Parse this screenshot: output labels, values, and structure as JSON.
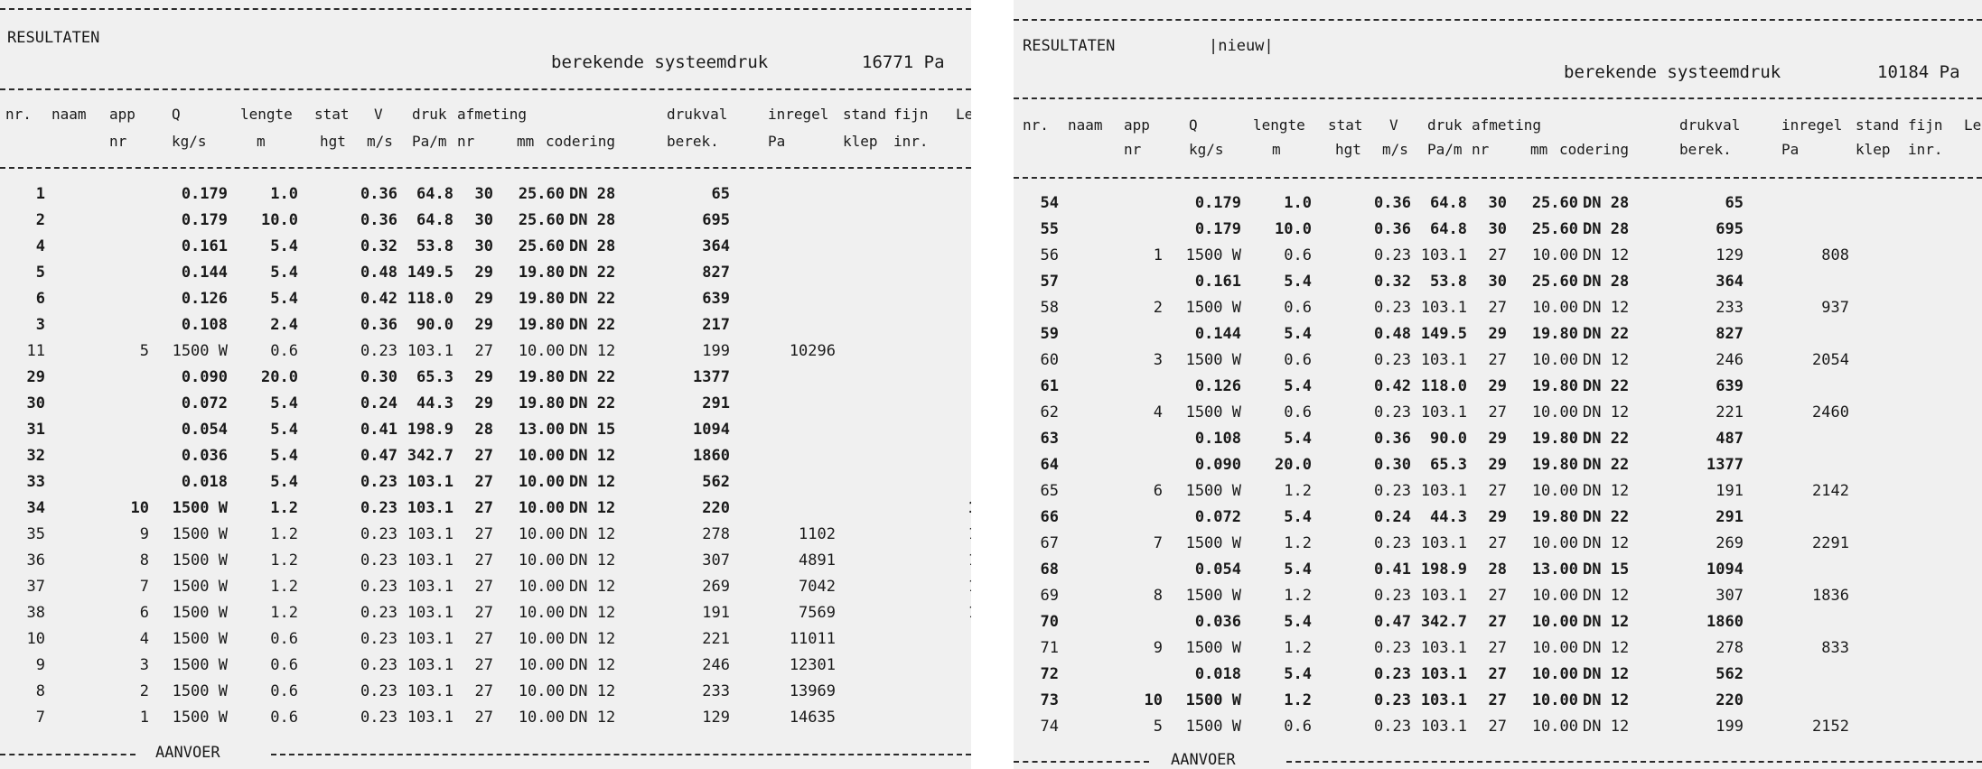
{
  "panels": [
    {
      "title": "RESULTATEN",
      "tag": "",
      "pressure_label": "berekende systeemdruk",
      "pressure_value": "16771 Pa",
      "footer_label": "AANVOER",
      "rows": [
        {
          "nr": "1",
          "app": "",
          "q": "0.179",
          "lengte": "1.0",
          "v": "0.36",
          "druk": "64.8",
          "anr": "30",
          "mm": "25.60",
          "cod": "DN 28",
          "val": "65",
          "inr": "",
          "x": "",
          "bold": true
        },
        {
          "nr": "2",
          "app": "",
          "q": "0.179",
          "lengte": "10.0",
          "v": "0.36",
          "druk": "64.8",
          "anr": "30",
          "mm": "25.60",
          "cod": "DN 28",
          "val": "695",
          "inr": "",
          "x": "",
          "bold": true
        },
        {
          "nr": "4",
          "app": "",
          "q": "0.161",
          "lengte": "5.4",
          "v": "0.32",
          "druk": "53.8",
          "anr": "30",
          "mm": "25.60",
          "cod": "DN 28",
          "val": "364",
          "inr": "",
          "x": "",
          "bold": true
        },
        {
          "nr": "5",
          "app": "",
          "q": "0.144",
          "lengte": "5.4",
          "v": "0.48",
          "druk": "149.5",
          "anr": "29",
          "mm": "19.80",
          "cod": "DN 22",
          "val": "827",
          "inr": "",
          "x": "",
          "bold": true
        },
        {
          "nr": "6",
          "app": "",
          "q": "0.126",
          "lengte": "5.4",
          "v": "0.42",
          "druk": "118.0",
          "anr": "29",
          "mm": "19.80",
          "cod": "DN 22",
          "val": "639",
          "inr": "",
          "x": "",
          "bold": true
        },
        {
          "nr": "3",
          "app": "",
          "q": "0.108",
          "lengte": "2.4",
          "v": "0.36",
          "druk": "90.0",
          "anr": "29",
          "mm": "19.80",
          "cod": "DN 22",
          "val": "217",
          "inr": "",
          "x": "",
          "bold": true
        },
        {
          "nr": "11",
          "app": "5",
          "q": "1500 W",
          "lengte": "0.6",
          "v": "0.23",
          "druk": "103.1",
          "anr": "27",
          "mm": "10.00",
          "cod": "DN 12",
          "val": "199",
          "inr": "10296",
          "x": "",
          "bold": false
        },
        {
          "nr": "29",
          "app": "",
          "q": "0.090",
          "lengte": "20.0",
          "v": "0.30",
          "druk": "65.3",
          "anr": "29",
          "mm": "19.80",
          "cod": "DN 22",
          "val": "1377",
          "inr": "",
          "x": "",
          "bold": true
        },
        {
          "nr": "30",
          "app": "",
          "q": "0.072",
          "lengte": "5.4",
          "v": "0.24",
          "druk": "44.3",
          "anr": "29",
          "mm": "19.80",
          "cod": "DN 22",
          "val": "291",
          "inr": "",
          "x": "",
          "bold": true
        },
        {
          "nr": "31",
          "app": "",
          "q": "0.054",
          "lengte": "5.4",
          "v": "0.41",
          "druk": "198.9",
          "anr": "28",
          "mm": "13.00",
          "cod": "DN 15",
          "val": "1094",
          "inr": "",
          "x": "",
          "bold": true
        },
        {
          "nr": "32",
          "app": "",
          "q": "0.036",
          "lengte": "5.4",
          "v": "0.47",
          "druk": "342.7",
          "anr": "27",
          "mm": "10.00",
          "cod": "DN 12",
          "val": "1860",
          "inr": "",
          "x": "",
          "bold": true
        },
        {
          "nr": "33",
          "app": "",
          "q": "0.018",
          "lengte": "5.4",
          "v": "0.23",
          "druk": "103.1",
          "anr": "27",
          "mm": "10.00",
          "cod": "DN 12",
          "val": "562",
          "inr": "",
          "x": "",
          "bold": true
        },
        {
          "nr": "34",
          "app": "10",
          "q": "1500 W",
          "lengte": "1.2",
          "v": "0.23",
          "druk": "103.1",
          "anr": "27",
          "mm": "10.00",
          "cod": "DN 12",
          "val": "220",
          "inr": "",
          "x": "1",
          "bold": true
        },
        {
          "nr": "35",
          "app": "9",
          "q": "1500 W",
          "lengte": "1.2",
          "v": "0.23",
          "druk": "103.1",
          "anr": "27",
          "mm": "10.00",
          "cod": "DN 12",
          "val": "278",
          "inr": "1102",
          "x": "1",
          "bold": false
        },
        {
          "nr": "36",
          "app": "8",
          "q": "1500 W",
          "lengte": "1.2",
          "v": "0.23",
          "druk": "103.1",
          "anr": "27",
          "mm": "10.00",
          "cod": "DN 12",
          "val": "307",
          "inr": "4891",
          "x": "1",
          "bold": false
        },
        {
          "nr": "37",
          "app": "7",
          "q": "1500 W",
          "lengte": "1.2",
          "v": "0.23",
          "druk": "103.1",
          "anr": "27",
          "mm": "10.00",
          "cod": "DN 12",
          "val": "269",
          "inr": "7042",
          "x": "1",
          "bold": false
        },
        {
          "nr": "38",
          "app": "6",
          "q": "1500 W",
          "lengte": "1.2",
          "v": "0.23",
          "druk": "103.1",
          "anr": "27",
          "mm": "10.00",
          "cod": "DN 12",
          "val": "191",
          "inr": "7569",
          "x": "1",
          "bold": false
        },
        {
          "nr": "10",
          "app": "4",
          "q": "1500 W",
          "lengte": "0.6",
          "v": "0.23",
          "druk": "103.1",
          "anr": "27",
          "mm": "10.00",
          "cod": "DN 12",
          "val": "221",
          "inr": "11011",
          "x": "",
          "bold": false
        },
        {
          "nr": "9",
          "app": "3",
          "q": "1500 W",
          "lengte": "0.6",
          "v": "0.23",
          "druk": "103.1",
          "anr": "27",
          "mm": "10.00",
          "cod": "DN 12",
          "val": "246",
          "inr": "12301",
          "x": "",
          "bold": false
        },
        {
          "nr": "8",
          "app": "2",
          "q": "1500 W",
          "lengte": "0.6",
          "v": "0.23",
          "druk": "103.1",
          "anr": "27",
          "mm": "10.00",
          "cod": "DN 12",
          "val": "233",
          "inr": "13969",
          "x": "",
          "bold": false
        },
        {
          "nr": "7",
          "app": "1",
          "q": "1500 W",
          "lengte": "0.6",
          "v": "0.23",
          "druk": "103.1",
          "anr": "27",
          "mm": "10.00",
          "cod": "DN 12",
          "val": "129",
          "inr": "14635",
          "x": "",
          "bold": false
        }
      ]
    },
    {
      "title": "RESULTATEN",
      "tag": "|nieuw|",
      "pressure_label": "berekende systeemdruk",
      "pressure_value": "10184 Pa",
      "footer_label": "AANVOER",
      "rows": [
        {
          "nr": "54",
          "app": "",
          "q": "0.179",
          "lengte": "1.0",
          "v": "0.36",
          "druk": "64.8",
          "anr": "30",
          "mm": "25.60",
          "cod": "DN 28",
          "val": "65",
          "inr": "",
          "x": "",
          "bold": true
        },
        {
          "nr": "55",
          "app": "",
          "q": "0.179",
          "lengte": "10.0",
          "v": "0.36",
          "druk": "64.8",
          "anr": "30",
          "mm": "25.60",
          "cod": "DN 28",
          "val": "695",
          "inr": "",
          "x": "",
          "bold": true
        },
        {
          "nr": "56",
          "app": "1",
          "q": "1500 W",
          "lengte": "0.6",
          "v": "0.23",
          "druk": "103.1",
          "anr": "27",
          "mm": "10.00",
          "cod": "DN 12",
          "val": "129",
          "inr": "808",
          "x": "",
          "bold": false
        },
        {
          "nr": "57",
          "app": "",
          "q": "0.161",
          "lengte": "5.4",
          "v": "0.32",
          "druk": "53.8",
          "anr": "30",
          "mm": "25.60",
          "cod": "DN 28",
          "val": "364",
          "inr": "",
          "x": "",
          "bold": true
        },
        {
          "nr": "58",
          "app": "2",
          "q": "1500 W",
          "lengte": "0.6",
          "v": "0.23",
          "druk": "103.1",
          "anr": "27",
          "mm": "10.00",
          "cod": "DN 12",
          "val": "233",
          "inr": "937",
          "x": "",
          "bold": false
        },
        {
          "nr": "59",
          "app": "",
          "q": "0.144",
          "lengte": "5.4",
          "v": "0.48",
          "druk": "149.5",
          "anr": "29",
          "mm": "19.80",
          "cod": "DN 22",
          "val": "827",
          "inr": "",
          "x": "",
          "bold": true
        },
        {
          "nr": "60",
          "app": "3",
          "q": "1500 W",
          "lengte": "0.6",
          "v": "0.23",
          "druk": "103.1",
          "anr": "27",
          "mm": "10.00",
          "cod": "DN 12",
          "val": "246",
          "inr": "2054",
          "x": "",
          "bold": false
        },
        {
          "nr": "61",
          "app": "",
          "q": "0.126",
          "lengte": "5.4",
          "v": "0.42",
          "druk": "118.0",
          "anr": "29",
          "mm": "19.80",
          "cod": "DN 22",
          "val": "639",
          "inr": "",
          "x": "",
          "bold": true
        },
        {
          "nr": "62",
          "app": "4",
          "q": "1500 W",
          "lengte": "0.6",
          "v": "0.23",
          "druk": "103.1",
          "anr": "27",
          "mm": "10.00",
          "cod": "DN 12",
          "val": "221",
          "inr": "2460",
          "x": "",
          "bold": false
        },
        {
          "nr": "63",
          "app": "",
          "q": "0.108",
          "lengte": "5.4",
          "v": "0.36",
          "druk": "90.0",
          "anr": "29",
          "mm": "19.80",
          "cod": "DN 22",
          "val": "487",
          "inr": "",
          "x": "",
          "bold": true
        },
        {
          "nr": "64",
          "app": "",
          "q": "0.090",
          "lengte": "20.0",
          "v": "0.30",
          "druk": "65.3",
          "anr": "29",
          "mm": "19.80",
          "cod": "DN 22",
          "val": "1377",
          "inr": "",
          "x": "",
          "bold": true
        },
        {
          "nr": "65",
          "app": "6",
          "q": "1500 W",
          "lengte": "1.2",
          "v": "0.23",
          "druk": "103.1",
          "anr": "27",
          "mm": "10.00",
          "cod": "DN 12",
          "val": "191",
          "inr": "2142",
          "x": "",
          "bold": false
        },
        {
          "nr": "66",
          "app": "",
          "q": "0.072",
          "lengte": "5.4",
          "v": "0.24",
          "druk": "44.3",
          "anr": "29",
          "mm": "19.80",
          "cod": "DN 22",
          "val": "291",
          "inr": "",
          "x": "",
          "bold": true
        },
        {
          "nr": "67",
          "app": "7",
          "q": "1500 W",
          "lengte": "1.2",
          "v": "0.23",
          "druk": "103.1",
          "anr": "27",
          "mm": "10.00",
          "cod": "DN 12",
          "val": "269",
          "inr": "2291",
          "x": "",
          "bold": false
        },
        {
          "nr": "68",
          "app": "",
          "q": "0.054",
          "lengte": "5.4",
          "v": "0.41",
          "druk": "198.9",
          "anr": "28",
          "mm": "13.00",
          "cod": "DN 15",
          "val": "1094",
          "inr": "",
          "x": "",
          "bold": true
        },
        {
          "nr": "69",
          "app": "8",
          "q": "1500 W",
          "lengte": "1.2",
          "v": "0.23",
          "druk": "103.1",
          "anr": "27",
          "mm": "10.00",
          "cod": "DN 12",
          "val": "307",
          "inr": "1836",
          "x": "",
          "bold": false
        },
        {
          "nr": "70",
          "app": "",
          "q": "0.036",
          "lengte": "5.4",
          "v": "0.47",
          "druk": "342.7",
          "anr": "27",
          "mm": "10.00",
          "cod": "DN 12",
          "val": "1860",
          "inr": "",
          "x": "",
          "bold": true
        },
        {
          "nr": "71",
          "app": "9",
          "q": "1500 W",
          "lengte": "1.2",
          "v": "0.23",
          "druk": "103.1",
          "anr": "27",
          "mm": "10.00",
          "cod": "DN 12",
          "val": "278",
          "inr": "833",
          "x": "",
          "bold": false
        },
        {
          "nr": "72",
          "app": "",
          "q": "0.018",
          "lengte": "5.4",
          "v": "0.23",
          "druk": "103.1",
          "anr": "27",
          "mm": "10.00",
          "cod": "DN 12",
          "val": "562",
          "inr": "",
          "x": "",
          "bold": true
        },
        {
          "nr": "73",
          "app": "10",
          "q": "1500 W",
          "lengte": "1.2",
          "v": "0.23",
          "druk": "103.1",
          "anr": "27",
          "mm": "10.00",
          "cod": "DN 12",
          "val": "220",
          "inr": "",
          "x": "",
          "bold": true
        },
        {
          "nr": "74",
          "app": "5",
          "q": "1500 W",
          "lengte": "0.6",
          "v": "0.23",
          "druk": "103.1",
          "anr": "27",
          "mm": "10.00",
          "cod": "DN 12",
          "val": "199",
          "inr": "2152",
          "x": "",
          "bold": false
        }
      ]
    }
  ],
  "columns": {
    "line1": [
      "nr.",
      "naam",
      "app",
      "Q",
      "lengte",
      "stat",
      "V",
      "druk",
      "afmeting",
      "drukval",
      "inregel",
      "stand",
      "fijn",
      "Le"
    ],
    "line2": [
      "nr",
      "kg/s",
      "m",
      "hgt",
      "m/s",
      "Pa/m",
      "nr",
      "mm",
      "codering",
      "berek.",
      "Pa",
      "klep",
      "inr."
    ]
  }
}
